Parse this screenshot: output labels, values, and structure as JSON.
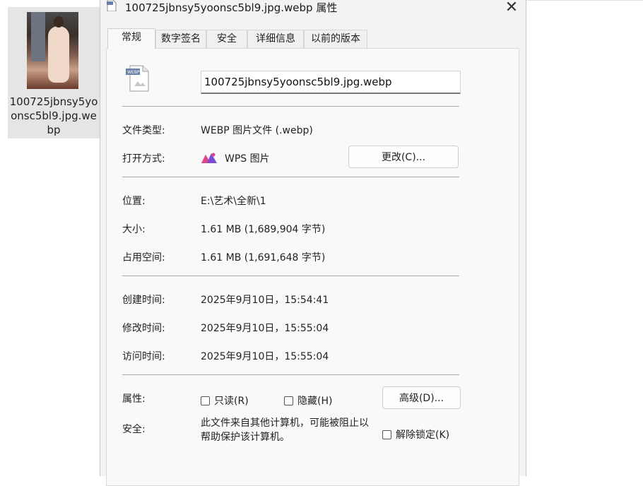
{
  "desktop": {
    "file_name": "100725jbnsy5yoonsc5bl9.jpg.webp"
  },
  "dialog": {
    "title": "100725jbnsy5yoonsc5bl9.jpg.webp 属性",
    "close_label": "✕",
    "tabs": [
      {
        "label": "常规",
        "active": true
      },
      {
        "label": "数字签名",
        "active": false
      },
      {
        "label": "安全",
        "active": false
      },
      {
        "label": "详细信息",
        "active": false
      },
      {
        "label": "以前的版本",
        "active": false
      }
    ],
    "file_icon_badge": "WEBP",
    "name_value": "100725jbnsy5yoonsc5bl9.jpg.webp",
    "file_type_label": "文件类型:",
    "file_type_value": "WEBP 图片文件 (.webp)",
    "open_with_label": "打开方式:",
    "open_with_value": "WPS 图片",
    "change_button": "更改(C)...",
    "location_label": "位置:",
    "location_value": "E:\\艺术\\全新\\1",
    "size_label": "大小:",
    "size_value": "1.61 MB (1,689,904 字节)",
    "disk_size_label": "占用空间:",
    "disk_size_value": "1.61 MB (1,691,648 字节)",
    "created_label": "创建时间:",
    "created_value": "2025年9月10日，15:54:41",
    "modified_label": "修改时间:",
    "modified_value": "2025年9月10日，15:55:04",
    "accessed_label": "访问时间:",
    "accessed_value": "2025年9月10日，15:55:04",
    "attributes_label": "属性:",
    "readonly_label": "只读(R)",
    "hidden_label": "隐藏(H)",
    "advanced_button": "高级(D)...",
    "security_label": "安全:",
    "security_text": "此文件来自其他计算机，可能被阻止以帮助保护该计算机。",
    "unblock_label": "解除锁定(K)"
  },
  "colors": {
    "wps_icon_pink": "#e0458b",
    "wps_icon_purple": "#7b4bd6",
    "tile_selected_bg": "#e5e5e5"
  }
}
